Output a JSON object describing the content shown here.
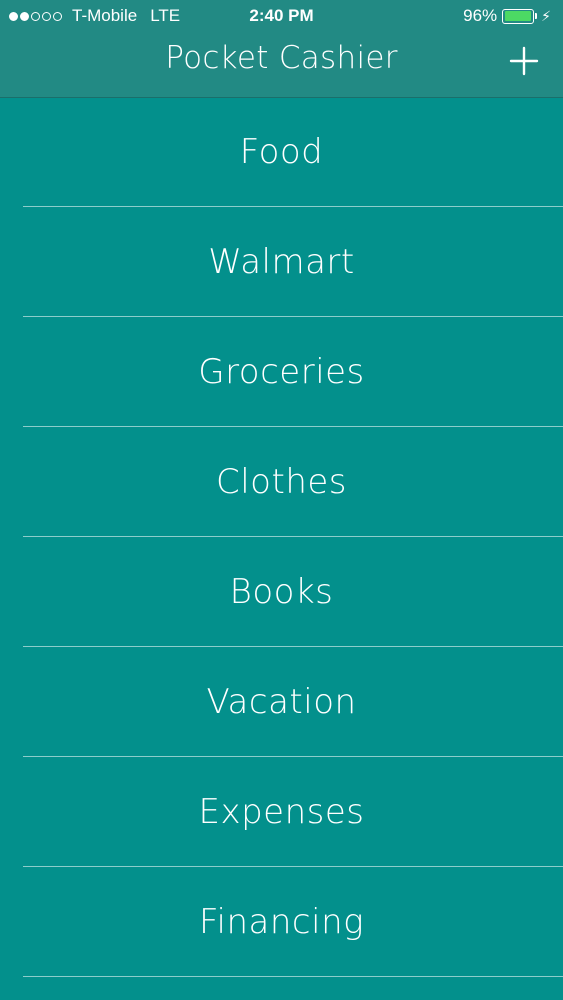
{
  "status_bar": {
    "signal_dots_filled": 2,
    "signal_dots_total": 5,
    "carrier": "T-Mobile",
    "network": "LTE",
    "time": "2:40 PM",
    "battery_percent": "96%",
    "battery_level": 0.96,
    "battery_color": "#4cd964",
    "charging_icon": "bolt-icon"
  },
  "nav": {
    "title": "Pocket Cashier",
    "add_icon": "plus-icon"
  },
  "categories": [
    {
      "label": "Food"
    },
    {
      "label": "Walmart"
    },
    {
      "label": "Groceries"
    },
    {
      "label": "Clothes"
    },
    {
      "label": "Books"
    },
    {
      "label": "Vacation"
    },
    {
      "label": "Expenses"
    },
    {
      "label": "Financing"
    }
  ],
  "colors": {
    "background": "#03908c",
    "nav_background": "#228a84",
    "text": "#ffffff"
  }
}
